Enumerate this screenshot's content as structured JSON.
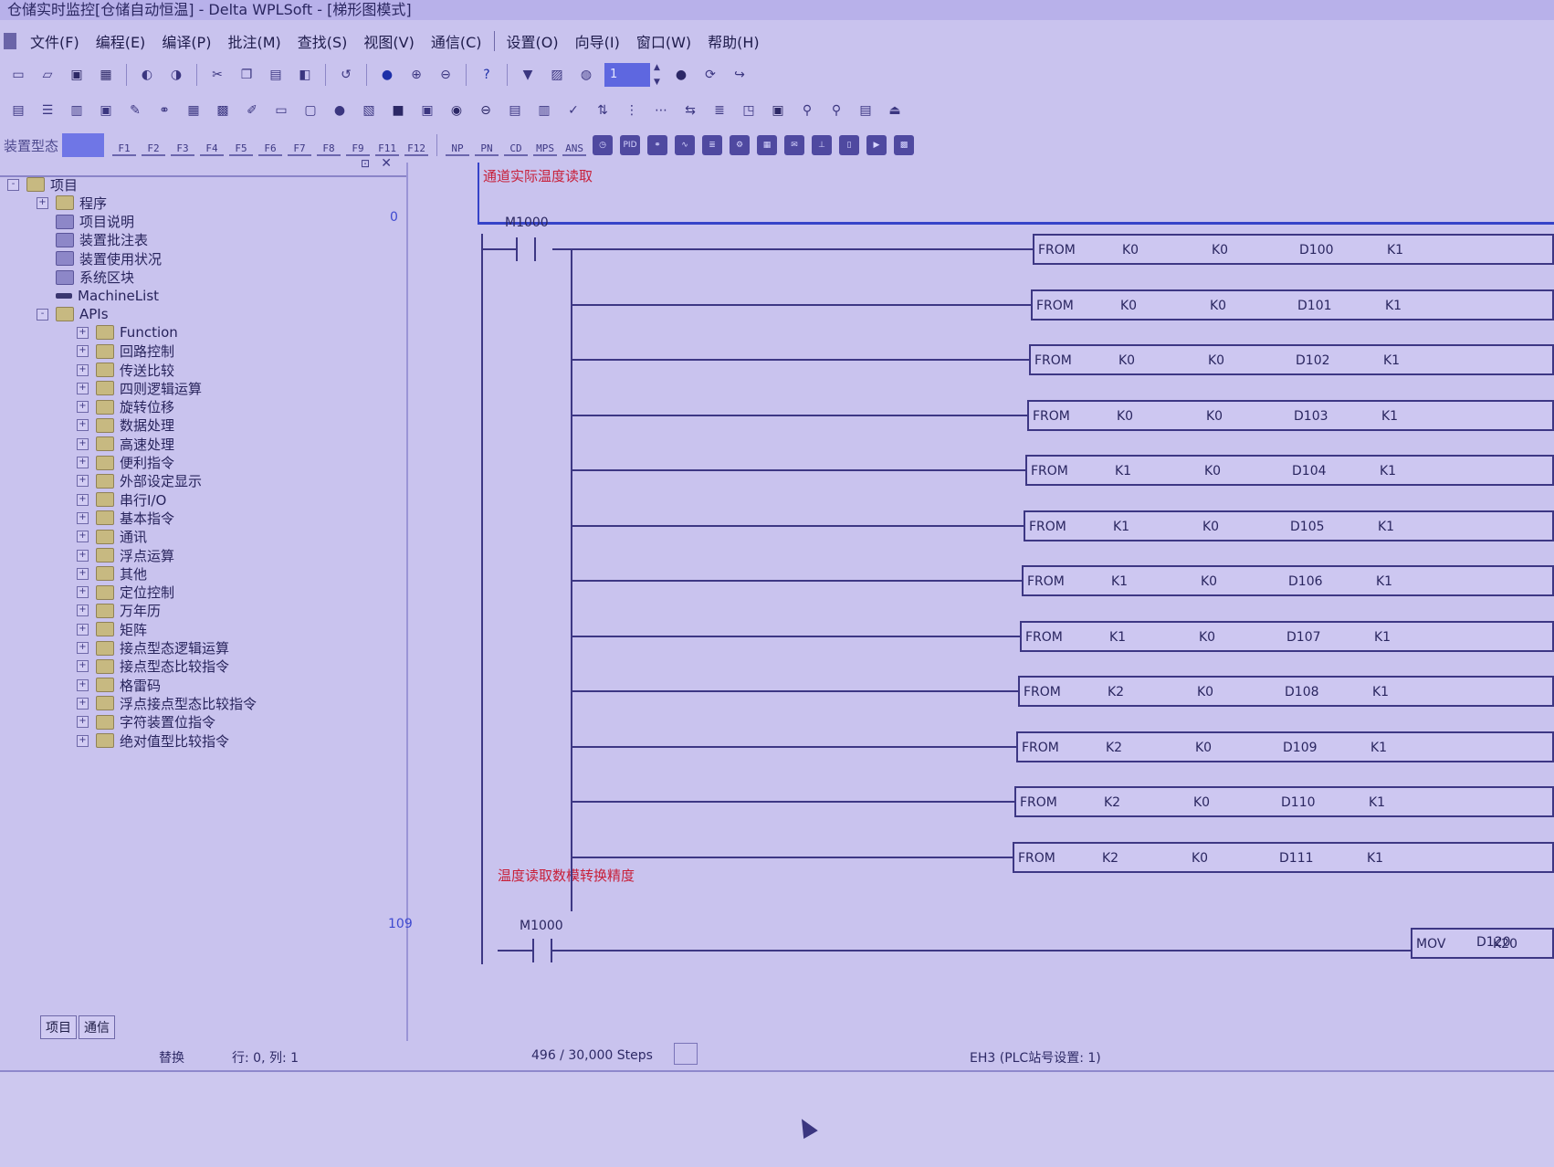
{
  "window": {
    "title": "仓储实时监控[仓储自动恒温] - Delta WPLSoft - [梯形图模式]"
  },
  "menu": [
    "文件(F)",
    "编程(E)",
    "编译(P)",
    "批注(M)",
    "查找(S)",
    "视图(V)",
    "通信(C)",
    "设置(O)",
    "向导(I)",
    "窗口(W)",
    "帮助(H)"
  ],
  "toolbar": {
    "step_value": "1",
    "device_type_label": "装置型态",
    "fkeys": [
      "F1",
      "F2",
      "F3",
      "F4",
      "F5",
      "F6",
      "F7",
      "F8",
      "F9",
      "F11",
      "F12",
      "NP",
      "PN",
      "CD",
      "MPS",
      "ANS"
    ],
    "special_icons": [
      "clock-icon",
      "pid-icon",
      "network-icon",
      "waveform-icon",
      "list-icon",
      "gear-icon",
      "table-icon",
      "mail-icon",
      "io-icon",
      "module-icon",
      "run-icon",
      "grid-icon"
    ]
  },
  "tree": {
    "items": [
      {
        "label": "项目",
        "level": 0,
        "expander": "-",
        "icon": "folder"
      },
      {
        "label": "程序",
        "level": 1,
        "expander": "+",
        "icon": "folder"
      },
      {
        "label": "项目说明",
        "level": 1,
        "expander": "",
        "icon": "doc"
      },
      {
        "label": "装置批注表",
        "level": 1,
        "expander": "",
        "icon": "doc"
      },
      {
        "label": "装置使用状况",
        "level": 1,
        "expander": "",
        "icon": "doc"
      },
      {
        "label": "系统区块",
        "level": 1,
        "expander": "",
        "icon": "doc"
      },
      {
        "label": "MachineList",
        "level": 1,
        "expander": "",
        "icon": "bar"
      },
      {
        "label": "APIs",
        "level": 1,
        "expander": "-",
        "icon": "folder"
      },
      {
        "label": "Function",
        "level": 2,
        "expander": "+",
        "icon": "folder"
      },
      {
        "label": "回路控制",
        "level": 2,
        "expander": "+",
        "icon": "folder"
      },
      {
        "label": "传送比较",
        "level": 2,
        "expander": "+",
        "icon": "folder"
      },
      {
        "label": "四则逻辑运算",
        "level": 2,
        "expander": "+",
        "icon": "folder"
      },
      {
        "label": "旋转位移",
        "level": 2,
        "expander": "+",
        "icon": "folder"
      },
      {
        "label": "数据处理",
        "level": 2,
        "expander": "+",
        "icon": "folder"
      },
      {
        "label": "高速处理",
        "level": 2,
        "expander": "+",
        "icon": "folder"
      },
      {
        "label": "便利指令",
        "level": 2,
        "expander": "+",
        "icon": "folder"
      },
      {
        "label": "外部设定显示",
        "level": 2,
        "expander": "+",
        "icon": "folder"
      },
      {
        "label": "串行I/O",
        "level": 2,
        "expander": "+",
        "icon": "folder"
      },
      {
        "label": "基本指令",
        "level": 2,
        "expander": "+",
        "icon": "folder"
      },
      {
        "label": "通讯",
        "level": 2,
        "expander": "+",
        "icon": "folder"
      },
      {
        "label": "浮点运算",
        "level": 2,
        "expander": "+",
        "icon": "folder"
      },
      {
        "label": "其他",
        "level": 2,
        "expander": "+",
        "icon": "folder"
      },
      {
        "label": "定位控制",
        "level": 2,
        "expander": "+",
        "icon": "folder"
      },
      {
        "label": "万年历",
        "level": 2,
        "expander": "+",
        "icon": "folder"
      },
      {
        "label": "矩阵",
        "level": 2,
        "expander": "+",
        "icon": "folder"
      },
      {
        "label": "接点型态逻辑运算",
        "level": 2,
        "expander": "+",
        "icon": "folder"
      },
      {
        "label": "接点型态比较指令",
        "level": 2,
        "expander": "+",
        "icon": "folder"
      },
      {
        "label": "格雷码",
        "level": 2,
        "expander": "+",
        "icon": "folder"
      },
      {
        "label": "浮点接点型态比较指令",
        "level": 2,
        "expander": "+",
        "icon": "folder"
      },
      {
        "label": "字符装置位指令",
        "level": 2,
        "expander": "+",
        "icon": "folder"
      },
      {
        "label": "绝对值型比较指令",
        "level": 2,
        "expander": "+",
        "icon": "folder"
      }
    ],
    "tabs": [
      "项目",
      "通信"
    ]
  },
  "ladder": {
    "line_numbers": [
      "0",
      "109"
    ],
    "comments": [
      "通道实际温度读取",
      "温度读取数模转换精度"
    ],
    "contacts": [
      "M1000",
      "M1000"
    ],
    "from_rows": [
      {
        "op": "FROM",
        "m1": "K0",
        "m2": "K0",
        "dest": "D100",
        "n": "K1"
      },
      {
        "op": "FROM",
        "m1": "K0",
        "m2": "K0",
        "dest": "D101",
        "n": "K1"
      },
      {
        "op": "FROM",
        "m1": "K0",
        "m2": "K0",
        "dest": "D102",
        "n": "K1"
      },
      {
        "op": "FROM",
        "m1": "K0",
        "m2": "K0",
        "dest": "D103",
        "n": "K1"
      },
      {
        "op": "FROM",
        "m1": "K1",
        "m2": "K0",
        "dest": "D104",
        "n": "K1"
      },
      {
        "op": "FROM",
        "m1": "K1",
        "m2": "K0",
        "dest": "D105",
        "n": "K1"
      },
      {
        "op": "FROM",
        "m1": "K1",
        "m2": "K0",
        "dest": "D106",
        "n": "K1"
      },
      {
        "op": "FROM",
        "m1": "K1",
        "m2": "K0",
        "dest": "D107",
        "n": "K1"
      },
      {
        "op": "FROM",
        "m1": "K2",
        "m2": "K0",
        "dest": "D108",
        "n": "K1"
      },
      {
        "op": "FROM",
        "m1": "K2",
        "m2": "K0",
        "dest": "D109",
        "n": "K1"
      },
      {
        "op": "FROM",
        "m1": "K2",
        "m2": "K0",
        "dest": "D110",
        "n": "K1"
      },
      {
        "op": "FROM",
        "m1": "K2",
        "m2": "K0",
        "dest": "D111",
        "n": "K1"
      }
    ],
    "mov": {
      "op": "MOV",
      "src": "K20",
      "dest": "D120"
    }
  },
  "status": {
    "mode": "替换",
    "position": "行: 0, 列: 1",
    "steps": "496 / 30,000 Steps",
    "plc": "EH3 (PLC站号设置: 1)"
  }
}
